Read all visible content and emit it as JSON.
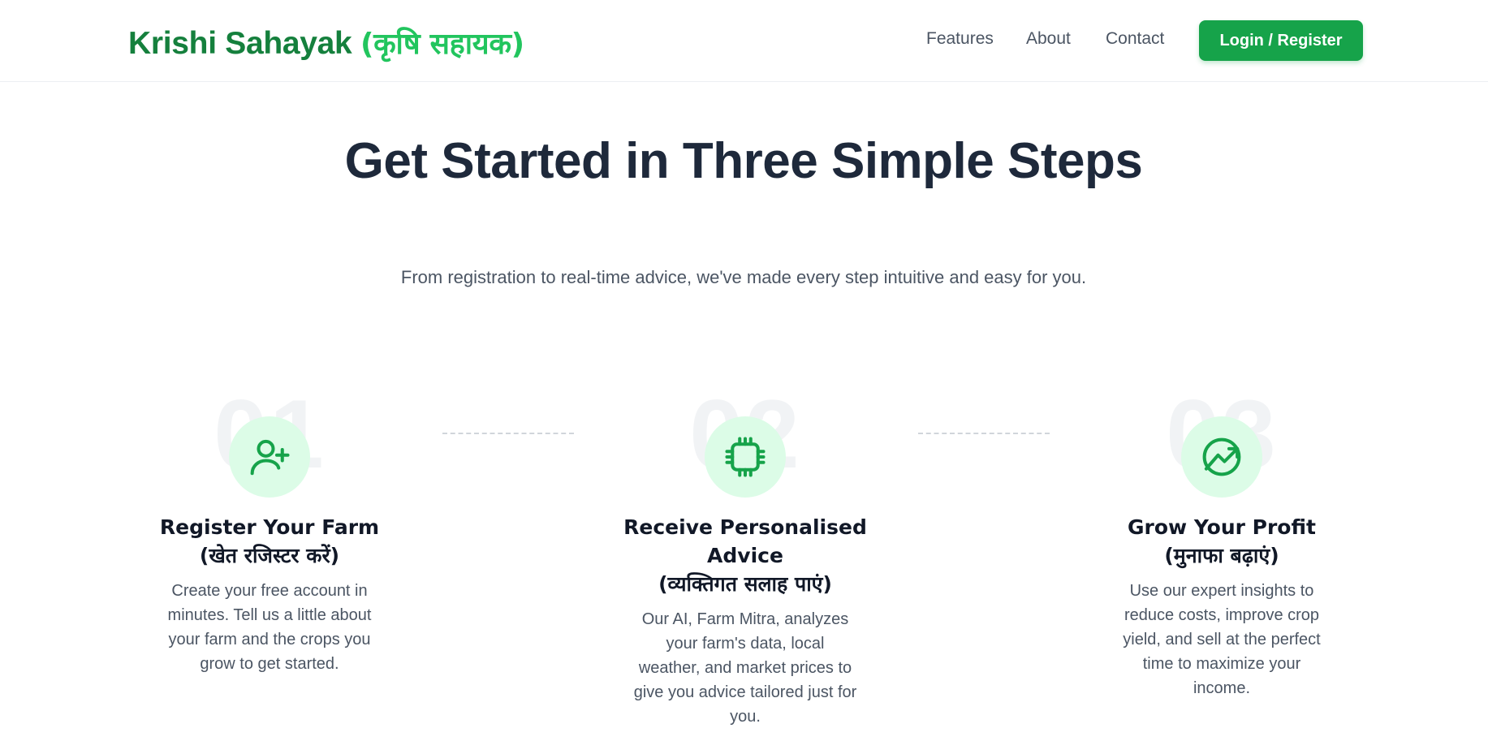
{
  "brand": {
    "name_en": "Krishi Sahayak",
    "name_hi": "(कृषि सहायक)",
    "color_primary": "#15803d",
    "color_secondary": "#22c55e"
  },
  "nav": {
    "links": [
      {
        "label": "Features"
      },
      {
        "label": "About"
      },
      {
        "label": "Contact"
      }
    ],
    "login_label": "Login / Register",
    "login_color": "#16a34a"
  },
  "hero": {
    "title": "Get Started in Three Simple Steps",
    "subtitle": "From registration to real-time advice, we've made every step intuitive and easy for you."
  },
  "steps": [
    {
      "number": "01",
      "icon": "user-plus-icon",
      "title_en": "Register Your Farm",
      "title_hi": "(खेत रजिस्टर करें)",
      "description": "Create your free account in minutes. Tell us a little about your farm and the crops you grow to get started."
    },
    {
      "number": "02",
      "icon": "cpu-chip-icon",
      "title_en": "Receive Personalised Advice",
      "title_hi": "(व्यक्तिगत सलाह पाएं)",
      "description": "Our AI, Farm Mitra, analyzes your farm's data, local weather, and market prices to give you advice tailored just for you."
    },
    {
      "number": "03",
      "icon": "trending-up-icon",
      "title_en": "Grow Your Profit",
      "title_hi": "(मुनाफा बढ़ाएं)",
      "description": "Use our expert insights to reduce costs, improve crop yield, and sell at the perfect time to maximize your income."
    }
  ]
}
